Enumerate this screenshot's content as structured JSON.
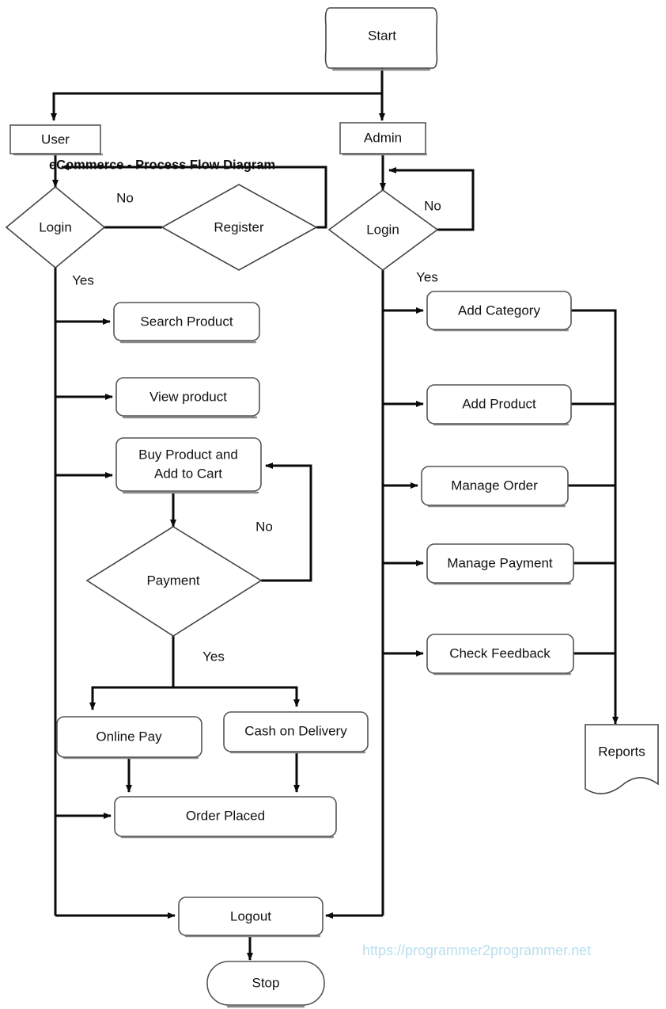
{
  "diagram": {
    "title": "eCommerce - Process Flow Diagram",
    "watermark": "https://programmer2programmer.net",
    "watermark_color": "#b8dff0",
    "line_color": "#0a0a0a",
    "shape_border_color": "#555555",
    "shape_fill_color": "#ffffff",
    "text_color": "#111111"
  },
  "nodes": {
    "start": {
      "label": "Start",
      "shape": "terminator"
    },
    "user": {
      "label": "User",
      "shape": "rect"
    },
    "admin": {
      "label": "Admin",
      "shape": "rect"
    },
    "user_login": {
      "label": "Login",
      "shape": "decision"
    },
    "register": {
      "label": "Register",
      "shape": "decision"
    },
    "admin_login": {
      "label": "Login",
      "shape": "decision"
    },
    "search_product": {
      "label": "Search Product",
      "shape": "rounded-rect"
    },
    "view_product": {
      "label": "View product",
      "shape": "rounded-rect"
    },
    "buy_product_line1": {
      "label": "Buy Product and",
      "shape": "rounded-rect"
    },
    "buy_product_line2": {
      "label": "Add to Cart",
      "shape": "rounded-rect"
    },
    "payment": {
      "label": "Payment",
      "shape": "decision"
    },
    "online_pay": {
      "label": "Online Pay",
      "shape": "rounded-rect"
    },
    "cash_on_delivery": {
      "label": "Cash on Delivery",
      "shape": "rounded-rect"
    },
    "order_placed": {
      "label": "Order Placed",
      "shape": "rounded-rect"
    },
    "add_category": {
      "label": "Add Category",
      "shape": "rounded-rect"
    },
    "add_product": {
      "label": "Add Product",
      "shape": "rounded-rect"
    },
    "manage_order": {
      "label": "Manage Order",
      "shape": "rounded-rect"
    },
    "manage_payment": {
      "label": "Manage Payment",
      "shape": "rounded-rect"
    },
    "check_feedback": {
      "label": "Check Feedback",
      "shape": "rounded-rect"
    },
    "reports": {
      "label": "Reports",
      "shape": "document"
    },
    "logout": {
      "label": "Logout",
      "shape": "rounded-rect"
    },
    "stop": {
      "label": "Stop",
      "shape": "terminator"
    }
  },
  "edge_labels": {
    "user_login_no": "No",
    "user_login_yes": "Yes",
    "admin_login_no": "No",
    "admin_login_yes": "Yes",
    "payment_no": "No",
    "payment_yes": "Yes"
  }
}
